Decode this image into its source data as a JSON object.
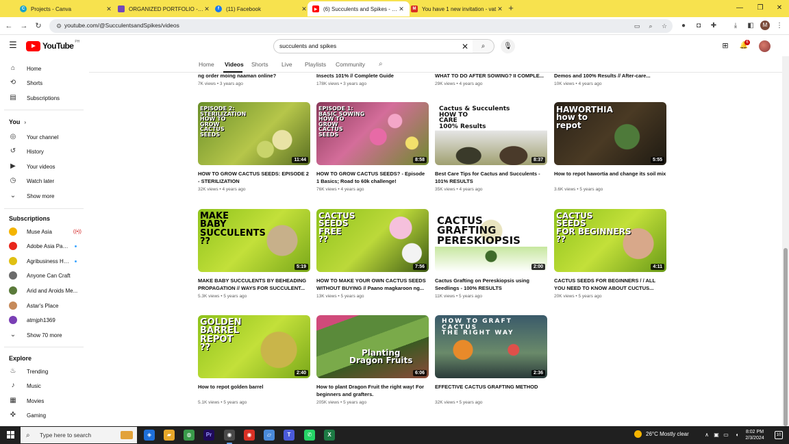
{
  "browser": {
    "tabs": [
      {
        "title": "Projects - Canva",
        "icon": "canva-icon",
        "color": "#1aa3c9"
      },
      {
        "title": "ORGANIZED PORTFOLIO - Web",
        "icon": "sites-icon",
        "color": "#7248b9"
      },
      {
        "title": "(11) Facebook",
        "icon": "facebook-icon",
        "color": "#1877f2"
      },
      {
        "title": "(6) Succulents and Spikes - You",
        "icon": "youtube-icon",
        "color": "#ff0000"
      },
      {
        "title": "You have 1 new invitation - vat",
        "icon": "gmail-icon",
        "color": "#d93025"
      }
    ],
    "url": "youtube.com/@SucculentsandSpikes/videos",
    "profile_initial": "M"
  },
  "youtube": {
    "logo_text": "YouTube",
    "country_code": "PH",
    "search_value": "succulents and spikes",
    "notification_count": "6",
    "channel_tabs": [
      "Home",
      "Videos",
      "Shorts",
      "Live",
      "Playlists",
      "Community"
    ]
  },
  "sidebar": {
    "primary": [
      "Home",
      "Shorts",
      "Subscriptions"
    ],
    "you_heading": "You",
    "you_items": [
      "Your channel",
      "History",
      "Your videos",
      "Watch later",
      "Show more"
    ],
    "subscriptions_heading": "Subscriptions",
    "subscriptions": [
      {
        "name": "Muse Asia",
        "color": "#f4b400",
        "badge": "live"
      },
      {
        "name": "Adobe Asia Paci...",
        "color": "#e8261c",
        "badge": "dot"
      },
      {
        "name": "Agribusiness Ho...",
        "color": "#e0c012",
        "badge": "dot"
      },
      {
        "name": "Anyone Can Craft",
        "color": "#6b6b6b",
        "badge": ""
      },
      {
        "name": "Arid and Aroids Me...",
        "color": "#5a7a3a",
        "badge": ""
      },
      {
        "name": "Astar's Place",
        "color": "#c68a5a",
        "badge": ""
      },
      {
        "name": "atmjph1369",
        "color": "#7a3fb5",
        "badge": ""
      }
    ],
    "show_more_subs": "Show 70 more",
    "explore_heading": "Explore",
    "explore_items": [
      "Trending",
      "Music",
      "Movies",
      "Gaming"
    ]
  },
  "videos_top_partial": [
    {
      "title": "ng order moing naaman online?",
      "meta": "7K views • 3 years ago"
    },
    {
      "title": "Insects 101% // Complete Guide",
      "meta": "178K views • 3 years ago"
    },
    {
      "title": "WHAT TO DO AFTER SOWING? II COMPLE...",
      "meta": "29K views • 4 years ago"
    },
    {
      "title": "Demos and 100% Results // After-care...",
      "meta": "10K views • 4 years ago"
    }
  ],
  "videos": [
    {
      "title": "HOW TO GROW CACTUS SEEDS: EPISODE 2 - STERILIZATION",
      "meta": "32K views • 4 years ago",
      "duration": "11:44",
      "caption": "EPISODE 2:\nSTERILIZATION\nHOW TO\nGROW\nCACTUS\nSEEDS"
    },
    {
      "title": "HOW TO GROW CACTUS SEEDS? - Episode 1 Basics; Road to 60k challenge!",
      "meta": "76K views • 4 years ago",
      "duration": "8:58",
      "caption": "EPISODE 1:\nBASIC SOWING\nHOW TO\nGROW\nCACTUS\nSEEDS"
    },
    {
      "title": "Best Care Tips for Cactus and Succulents - 101% RESULTS",
      "meta": "35K views • 4 years ago",
      "duration": "8:37",
      "caption": "Cactus & Succulents\nHOW TO\nCARE\n100% Results"
    },
    {
      "title": "How to repot hawortia and change its soil mix",
      "meta": "3.6K views • 5 years ago",
      "duration": "5:55",
      "caption": "HAWORTHIA\nhow to\nrepot"
    },
    {
      "title": "MAKE BABY SUCCULENTS BY BEHEADING PROPAGATION // WAYS FOR SUCCULENT...",
      "meta": "5.3K views • 5 years ago",
      "duration": "5:19",
      "caption": "MAKE\nBABY\nSUCCULENTS\n??"
    },
    {
      "title": "HOW TO MAKE YOUR OWN CACTUS SEEDS WITHOUT BUYING // Paano magkaroon ng...",
      "meta": "13K views • 5 years ago",
      "duration": "7:56",
      "caption": "CACTUS\nSEEDS\nFREE\n??"
    },
    {
      "title": "Cactus Grafting on Pereskiopsis using Seedlings - 100% RESULTS",
      "meta": "11K views • 5 years ago",
      "duration": "2:00",
      "caption": "CACTUS\nGRAFTING\nPERESKIOPSIS"
    },
    {
      "title": "CACTUS SEEDS FOR BEGINNERS / / ALL YOU NEED TO KNOW ABOUT CUCTUS...",
      "meta": "20K views • 5 years ago",
      "duration": "4:11",
      "caption": "CACTUS\nSEEDS\nFOR BEGINNERS\n??"
    },
    {
      "title": "How to repot golden barrel",
      "meta": "5.1K views • 5 years ago",
      "duration": "2:40",
      "caption": "GOLDEN\nBARREL\nREPOT\n??"
    },
    {
      "title": "How to plant Dragon Fruit the right way! For beginners and grafters.",
      "meta": "205K views • 5 years ago",
      "duration": "6:06",
      "caption": "Planting\nDragon Fruits"
    },
    {
      "title": "EFFECTIVE CACTUS GRAFTING METHOD",
      "meta": "32K views • 5 years ago",
      "duration": "2:36",
      "caption": "HOW TO GRAFT\nCACTUS\nTHE RIGHT WAY"
    }
  ],
  "taskbar": {
    "search_placeholder": "Type here to search",
    "weather": "26°C  Mostly clear",
    "time": "8:02 PM",
    "date": "2/3/2024",
    "notification_count": "10"
  }
}
